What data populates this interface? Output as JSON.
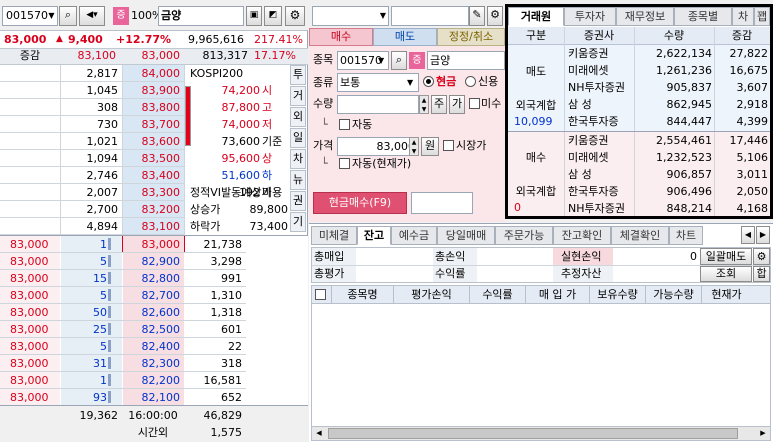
{
  "left": {
    "code": "001570",
    "badge": "증",
    "margin": "100%",
    "name": "금양",
    "price": "83,000",
    "change": "9,400",
    "rate": "+12.77%",
    "volume": "9,965,616",
    "vol_ratio": "217.41%",
    "hdr_label": "증감",
    "hdr_prev": "83,100",
    "hdr_cur": "83,000",
    "hdr_qty": "813,317",
    "hdr_pct": "17.17%",
    "ask_qty": [
      "2,817",
      "1,045",
      "308",
      "730",
      "1,021",
      "1,094",
      "2,746",
      "2,007",
      "2,700",
      "4,894"
    ],
    "ask_px": [
      "84,000",
      "83,900",
      "83,800",
      "83,700",
      "83,600",
      "83,500",
      "83,400",
      "83,300",
      "83,200",
      "83,100"
    ],
    "info_title": "KOSPI200",
    "info_rows": [
      {
        "v": "74,200",
        "k": "시"
      },
      {
        "v": "87,800",
        "k": "고"
      },
      {
        "v": "74,000",
        "k": "저"
      },
      {
        "v": "73,600",
        "k": "기준"
      },
      {
        "v": "95,600",
        "k": "상"
      },
      {
        "v": "51,600",
        "k": "하"
      },
      {
        "v": "192",
        "k": "비용"
      }
    ],
    "side_tabs": [
      "투",
      "거",
      "외",
      "일",
      "차",
      "뉴",
      "권",
      "기"
    ],
    "bottom_info": [
      {
        "k": "정적VI발동예상가",
        "v": ""
      },
      {
        "k": "상승가",
        "v": "89,800"
      },
      {
        "k": "하락가",
        "v": "73,400"
      }
    ],
    "bid_prev": [
      "83,000",
      "83,000",
      "83,000",
      "83,000",
      "83,000",
      "83,000",
      "83,000",
      "83,000",
      "83,000",
      "83,000"
    ],
    "bid_mid": [
      "1",
      "5",
      "15",
      "5",
      "50",
      "25",
      "5",
      "31",
      "1",
      "93"
    ],
    "bid_px": [
      "83,000",
      "82,900",
      "82,800",
      "82,700",
      "82,600",
      "82,500",
      "82,400",
      "82,300",
      "82,200",
      "82,100"
    ],
    "bid_qty": [
      "21,738",
      "3,298",
      "991",
      "1,310",
      "1,318",
      "601",
      "22",
      "318",
      "16,581",
      "652"
    ],
    "sum_ask": "19,362",
    "time": "16:00:00",
    "sum_bid": "46,829",
    "after_label": "시간외",
    "after_val": "1,575"
  },
  "order": {
    "tabs": [
      "매수",
      "매도",
      "정정/취소"
    ],
    "code_label": "종목",
    "code": "001570",
    "badge": "증",
    "name": "금양",
    "type_label": "종류",
    "type_value": "보통",
    "radio_cash": "현금",
    "radio_credit": "신용",
    "qty_label": "수량",
    "qty_btn1": "주",
    "qty_btn2": "가",
    "chk_mi": "미수",
    "auto_label": "자동",
    "price_label": "가격",
    "price": "83,000",
    "won": "원",
    "market_label": "시장가",
    "auto_cur": "자동(현재가)",
    "submit": "현금매수(F9)"
  },
  "broker": {
    "tabs": [
      "거래원",
      "투자자",
      "재무정보",
      "종목별",
      "차",
      "꽵"
    ],
    "headers": [
      "구분",
      "증권사",
      "수량",
      "증감"
    ],
    "sell_label": "매도",
    "sell": [
      {
        "n": "키움증권",
        "q": "2,622,134",
        "d": "27,822"
      },
      {
        "n": "미래에셋",
        "q": "1,261,236",
        "d": "16,675"
      },
      {
        "n": "NH투자증권",
        "q": "905,837",
        "d": "3,607"
      },
      {
        "n": "삼 성",
        "q": "862,945",
        "d": "2,918"
      },
      {
        "n": "한국투자증",
        "q": "844,447",
        "d": "4,399"
      }
    ],
    "foreign_label": "외국계합",
    "foreign_sell": "10,099",
    "buy_label": "매수",
    "buy": [
      {
        "n": "키움증권",
        "q": "2,554,461",
        "d": "17,446"
      },
      {
        "n": "미래에셋",
        "q": "1,232,523",
        "d": "5,106"
      },
      {
        "n": "삼 성",
        "q": "906,857",
        "d": "3,011"
      },
      {
        "n": "한국투자증",
        "q": "906,496",
        "d": "2,050"
      },
      {
        "n": "NH투자증권",
        "q": "848,214",
        "d": "4,168"
      }
    ],
    "foreign_buy": "0"
  },
  "balance": {
    "tabs": [
      "미체결",
      "잔고",
      "예수금",
      "당일매매",
      "주문가능",
      "잔고확인",
      "체결확인",
      "차트"
    ],
    "r1": [
      {
        "k": "총매입"
      },
      {
        "k": "총손익"
      },
      {
        "k": "실현손익"
      },
      {
        "v": "0"
      },
      {
        "k": "일괄매도"
      }
    ],
    "r2": [
      {
        "k": "총평가"
      },
      {
        "k": "수익률"
      },
      {
        "k": "추정자산"
      },
      {
        "k": "조회"
      },
      {
        "k": "합"
      }
    ],
    "cols": [
      "종목명",
      "평가손익",
      "수익률",
      "매 입 가",
      "보유수량",
      "가능수량",
      "현재가"
    ]
  }
}
